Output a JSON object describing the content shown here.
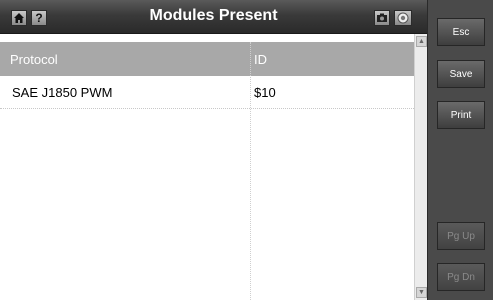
{
  "window": {
    "title": "Modules Present"
  },
  "toolbar": {
    "help_label": "?"
  },
  "table": {
    "columns": [
      "Protocol",
      "ID"
    ],
    "rows": [
      [
        "SAE J1850 PWM",
        "$10"
      ]
    ]
  },
  "sidebar": {
    "esc": "Esc",
    "save": "Save",
    "print": "Print",
    "pgup": "Pg Up",
    "pgdn": "Pg Dn"
  },
  "icons": {
    "home": "home-icon",
    "camera": "camera-icon",
    "record": "record-icon"
  }
}
